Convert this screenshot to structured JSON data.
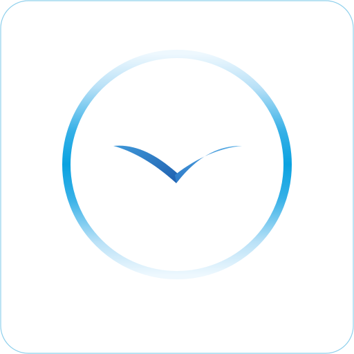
{
  "icon": {
    "name": "clock-bird-app-icon",
    "colors": {
      "background": "#ffffff",
      "tile_border": "#8fd0ec",
      "ring_strong": "#0aa2e0",
      "ring_mid": "#63c1ee",
      "ring_faint": "#e6f5fd",
      "bird_dark": "#1f66b8",
      "bird_light": "#3f98d9"
    }
  }
}
